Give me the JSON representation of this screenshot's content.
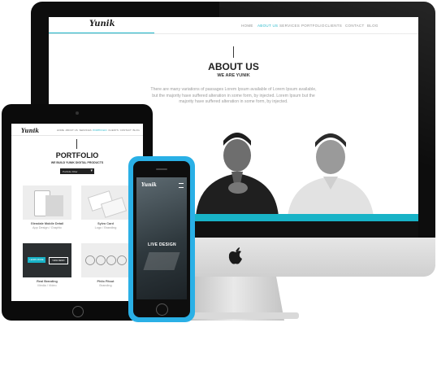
{
  "imac": {
    "logo": "Yunik",
    "nav": [
      "HOME",
      "ABOUT US",
      "SERVICES",
      "PORTFOLIO",
      "CLIENTS",
      "CONTACT",
      "BLOG"
    ],
    "active_nav": "ABOUT US",
    "title": "ABOUT US",
    "subtitle": "WE ARE YUNIK",
    "paragraph_lines": [
      "There are many variations of passages Lorem Ipsum available of Lorem Ipsum available,",
      "but the majority have suffered alteration in some form, by injected. Lorem Ipsum but the",
      "majority have suffered alteration in some form, by injected."
    ]
  },
  "ipad": {
    "logo": "Yunik",
    "nav": [
      "HOME",
      "ABOUT US",
      "SERVICES",
      "PORTFOLIO",
      "CLIENTS",
      "CONTACT",
      "BLOG"
    ],
    "title": "PORTFOLIO",
    "subtitle": "WE BUILD YUNIK DIGITAL PRODUCTS",
    "filter_label": "Portfolio Filter",
    "items": [
      {
        "title": "Glendale Mobile Detail",
        "caption": "App Design / Graphic"
      },
      {
        "title": "Sylvo Card",
        "caption": "Logo / Branding"
      },
      {
        "title": "Real Branding",
        "caption": "Media / Video"
      },
      {
        "title": "Philo Fitout",
        "caption": "Branding"
      }
    ],
    "tile_buttons": [
      "LEARN MORE",
      "VIEW DEMO"
    ]
  },
  "phone": {
    "logo": "Yunik",
    "hero_text": "LIVE DESIGN"
  },
  "colors": {
    "accent": "#18b3c7",
    "phone_shell": "#2ab0e6"
  }
}
